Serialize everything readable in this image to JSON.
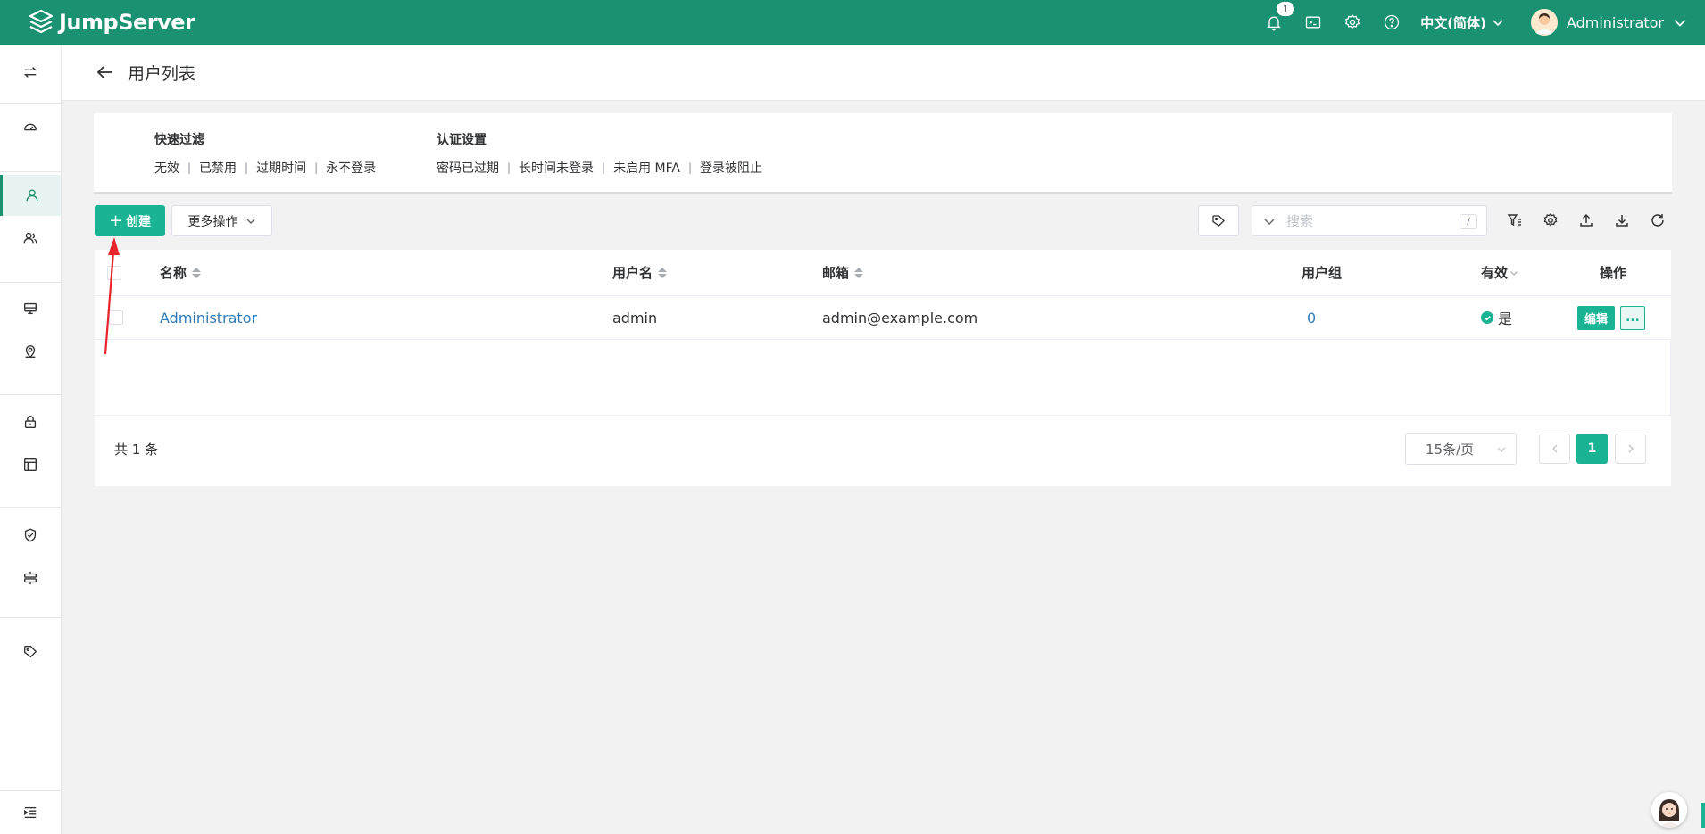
{
  "app": {
    "logo_text": "JumpServer",
    "notification_count": "1",
    "language": "中文(简体)",
    "username": "Administrator"
  },
  "page": {
    "title": "用户列表"
  },
  "filters": {
    "quick": {
      "title": "快速过滤",
      "items": [
        "无效",
        "已禁用",
        "过期时间",
        "永不登录"
      ]
    },
    "auth": {
      "title": "认证设置",
      "items": [
        "密码已过期",
        "长时间未登录",
        "未启用 MFA",
        "登录被阻止"
      ]
    }
  },
  "toolbar": {
    "create_label": "创建",
    "more_label": "更多操作",
    "search_placeholder": "搜索",
    "search_shortcut": "/"
  },
  "table": {
    "columns": {
      "name": "名称",
      "username": "用户名",
      "email": "邮箱",
      "groups": "用户组",
      "valid": "有效",
      "actions": "操作"
    },
    "rows": [
      {
        "name": "Administrator",
        "username": "admin",
        "email": "admin@example.com",
        "groups": "0",
        "valid": "是",
        "edit_label": "编辑",
        "more_label": "..."
      }
    ]
  },
  "pagination": {
    "total": "共 1 条",
    "page_size": "15条/页",
    "current_page": "1"
  },
  "colors": {
    "header": "#1a9171",
    "primary": "#1ab394",
    "link": "#337ab7"
  }
}
